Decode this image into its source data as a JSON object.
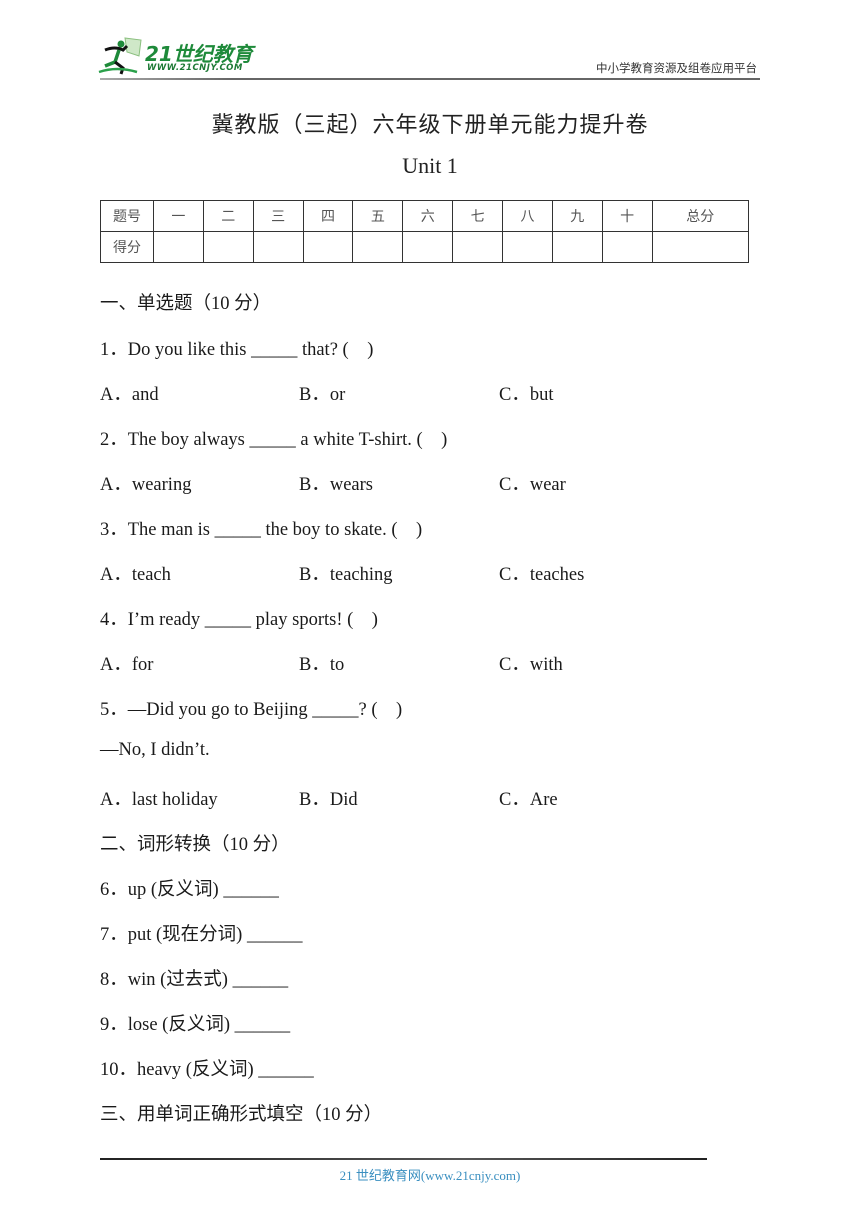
{
  "header": {
    "logo_text": "21世纪教育",
    "logo_url": "WWW.21CNJY.COM",
    "logo_icon": "running-figure-icon",
    "platform": "中小学教育资源及组卷应用平台"
  },
  "title": "冀教版（三起）六年级下册单元能力提升卷",
  "subtitle": "Unit 1",
  "score_table": {
    "row1_label": "题号",
    "row2_label": "得分",
    "columns": [
      "一",
      "二",
      "三",
      "四",
      "五",
      "六",
      "七",
      "八",
      "九",
      "十",
      "总分"
    ],
    "scores": [
      "",
      "",
      "",
      "",
      "",
      "",
      "",
      "",
      "",
      "",
      ""
    ]
  },
  "sections": [
    {
      "heading": "一、单选题（10 分）",
      "questions": [
        {
          "text": "1．Do you like this _____ that? (    )",
          "options": [
            "A．and",
            "B．or",
            "C．but"
          ]
        },
        {
          "text": "2．The boy always _____ a white T-shirt. (    )",
          "options": [
            "A．wearing",
            "B．wears",
            "C．wear"
          ]
        },
        {
          "text": "3．The man is _____ the boy to skate. (    )",
          "options": [
            "A．teach",
            "B．teaching",
            "C．teaches"
          ]
        },
        {
          "text": "4．I’m ready _____ play sports! (    )",
          "options": [
            "A．for",
            "B．to",
            "C．with"
          ]
        },
        {
          "text": "5．—Did you go to Beijing _____? (    )",
          "extra": "—No, I didn’t.",
          "options": [
            "A．last holiday",
            "B．Did",
            "C．Are"
          ]
        }
      ]
    },
    {
      "heading": "二、词形转换（10 分）",
      "questions": [
        {
          "text": "6．up (反义词) ______"
        },
        {
          "text": "7．put (现在分词) ______"
        },
        {
          "text": "8．win (过去式) ______"
        },
        {
          "text": "9．lose (反义词) ______"
        },
        {
          "text": "10．heavy (反义词) ______"
        }
      ]
    },
    {
      "heading": "三、用单词正确形式填空（10 分）"
    }
  ],
  "footer": "21 世纪教育网(www.21cnjy.com)"
}
